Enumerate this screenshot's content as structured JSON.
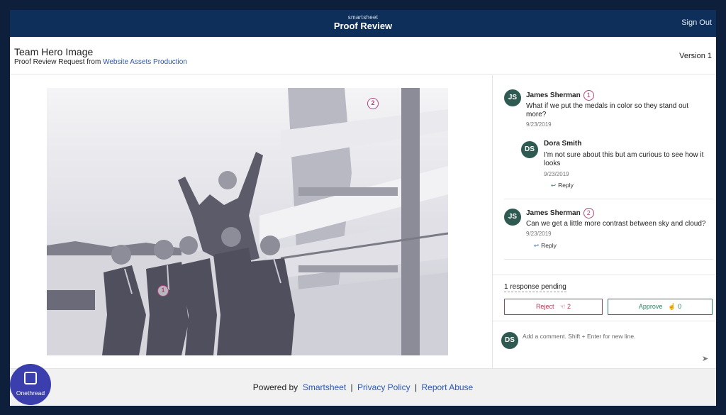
{
  "app": {
    "brand_small": "smartsheet",
    "brand_title": "Proof Review",
    "sign_out": "Sign Out"
  },
  "proof": {
    "title": "Team Hero Image",
    "subtitle_prefix": "Proof Review Request from",
    "subtitle_link": "Website Assets Production",
    "version": "Version 1"
  },
  "image": {
    "markers": [
      "1",
      "2"
    ]
  },
  "comments": [
    {
      "initials": "JS",
      "author": "James Sherman",
      "marker": "1",
      "text": "What if we put the medals in color so they stand out more?",
      "date": "9/23/2019",
      "replies": [
        {
          "initials": "DS",
          "author": "Dora Smith",
          "text": "I'm not sure about this but am curious to see how it looks",
          "date": "9/23/2019",
          "reply_label": "Reply"
        }
      ]
    },
    {
      "initials": "JS",
      "author": "James Sherman",
      "marker": "2",
      "text": "Can we get a little more contrast between sky and cloud?",
      "date": "9/23/2019",
      "reply_label": "Reply"
    }
  ],
  "review": {
    "pending": "1 response pending",
    "reject_label": "Reject",
    "reject_count": "2",
    "approve_label": "Approve",
    "approve_count": "0"
  },
  "composer": {
    "initials": "DS",
    "placeholder": "Add a comment. Shift + Enter for new line."
  },
  "footer": {
    "powered_by": "Powered by",
    "smartsheet_link": "Smartsheet",
    "privacy_link": "Privacy Policy",
    "abuse_link": "Report Abuse",
    "separator": "|"
  },
  "badge": {
    "label": "Onethread"
  },
  "colors": {
    "top_bar": "#0f2f5b",
    "background": "#0d1f3a",
    "marker": "#b2457f",
    "avatar": "#2f5a52",
    "reject": "#b93a4c",
    "approve": "#2e7d62",
    "link": "#2b57b5"
  }
}
